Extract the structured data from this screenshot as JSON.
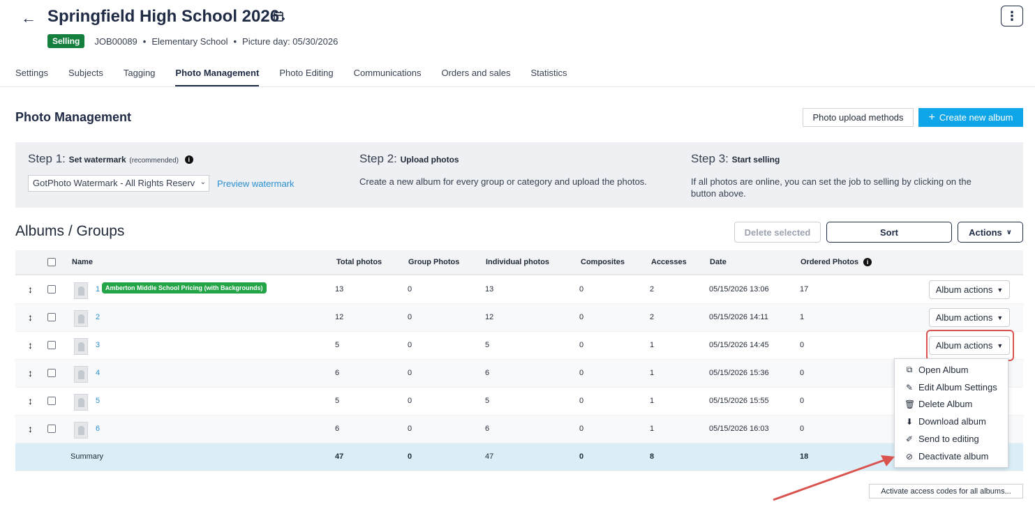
{
  "header": {
    "title": "Springfield High School 2026",
    "status_badge": "Selling",
    "job_id": "JOB00089",
    "school_type": "Elementary School",
    "picture_day": "Picture day: 05/30/2026",
    "separator": "•"
  },
  "tabs": [
    {
      "label": "Settings"
    },
    {
      "label": "Subjects"
    },
    {
      "label": "Tagging"
    },
    {
      "label": "Photo Management",
      "active": true
    },
    {
      "label": "Photo Editing"
    },
    {
      "label": "Communications"
    },
    {
      "label": "Orders and sales"
    },
    {
      "label": "Statistics"
    }
  ],
  "photo_management": {
    "title": "Photo Management",
    "upload_methods_label": "Photo upload methods",
    "create_album_label": "Create new album",
    "create_album_icon": "+"
  },
  "steps": {
    "step1": {
      "prefix": "Step 1:",
      "title": "Set watermark",
      "note": "(recommended)",
      "info_icon": "i",
      "watermark_value": "GotPhoto Watermark - All Rights Reserv",
      "select_caret": "⌄",
      "preview_label": "Preview watermark"
    },
    "step2": {
      "prefix": "Step 2:",
      "title": "Upload photos",
      "text": "Create a new album for every group or category and upload the photos."
    },
    "step3": {
      "prefix": "Step 3:",
      "title": "Start selling",
      "text": "If all photos are online, you can set the job to selling by clicking on the button above."
    }
  },
  "albums": {
    "title": "Albums / Groups",
    "delete_selected_label": "Delete selected",
    "sort_label": "Sort",
    "actions_label": "Actions",
    "actions_chevron": "∨",
    "album_actions_label": "Album actions",
    "album_actions_caret": "▼",
    "drag_icon": "↕",
    "columns": {
      "name": "Name",
      "total_photos": "Total photos",
      "group_photos": "Group Photos",
      "individual_photos": "Individual photos",
      "composites": "Composites",
      "accesses": "Accesses",
      "date": "Date",
      "ordered_photos": "Ordered Photos",
      "info_icon": "i"
    },
    "rows": [
      {
        "name": "1",
        "badge": "Amberton Middle School Pricing (with Backgrounds)",
        "total": "13",
        "group": "0",
        "individual": "13",
        "composites": "0",
        "accesses": "2",
        "date": "05/15/2026 13:06",
        "ordered": "17"
      },
      {
        "name": "2",
        "total": "12",
        "group": "0",
        "individual": "12",
        "composites": "0",
        "accesses": "2",
        "date": "05/15/2026 14:11",
        "ordered": "1"
      },
      {
        "name": "3",
        "total": "5",
        "group": "0",
        "individual": "5",
        "composites": "0",
        "accesses": "1",
        "date": "05/15/2026 14:45",
        "ordered": "0"
      },
      {
        "name": "4",
        "total": "6",
        "group": "0",
        "individual": "6",
        "composites": "0",
        "accesses": "1",
        "date": "05/15/2026 15:36",
        "ordered": "0"
      },
      {
        "name": "5",
        "total": "5",
        "group": "0",
        "individual": "5",
        "composites": "0",
        "accesses": "1",
        "date": "05/15/2026 15:55",
        "ordered": "0"
      },
      {
        "name": "6",
        "total": "6",
        "group": "0",
        "individual": "6",
        "composites": "0",
        "accesses": "1",
        "date": "05/15/2026 16:03",
        "ordered": "0"
      }
    ],
    "summary": {
      "label": "Summary",
      "total": "47",
      "group": "0",
      "individual": "47",
      "composites": "0",
      "accesses": "8",
      "ordered": "18"
    }
  },
  "album_menu": {
    "items": [
      {
        "label": "Open Album",
        "icon": "⧉",
        "icon_name": "open-external-icon"
      },
      {
        "label": "Edit Album Settings",
        "icon": "✎",
        "icon_name": "pencil-icon"
      },
      {
        "label": "Delete Album",
        "icon": "🗑",
        "icon_name": "trash-icon"
      },
      {
        "label": "Download album",
        "icon": "⬇",
        "icon_name": "download-file-icon"
      },
      {
        "label": "Send to editing",
        "icon": "✐",
        "icon_name": "edit-square-icon"
      },
      {
        "label": "Deactivate album",
        "icon": "⊘",
        "icon_name": "ban-icon"
      }
    ]
  },
  "footer": {
    "activate_label": "Activate access codes for all albums..."
  },
  "colors": {
    "brand_dark": "#1f2a44",
    "primary_blue": "#0ea5e9",
    "link_blue": "#2b8fd1",
    "selling_green": "#15803d",
    "badge_green": "#22a447",
    "annotation_red": "#d9534f",
    "summary_bg": "#dbeef7"
  }
}
